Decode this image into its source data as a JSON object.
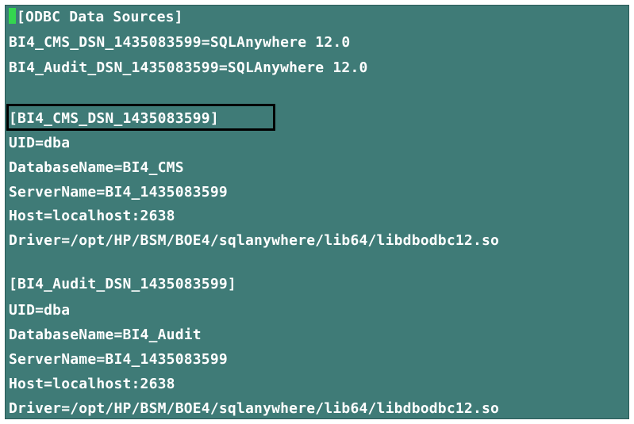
{
  "terminal": {
    "background": "#3f7b77",
    "text_color": "#ffffff",
    "cursor_color": "#34d64f",
    "highlight_border_color": "#000000",
    "lines": [
      "[ODBC Data Sources]",
      "BI4_CMS_DSN_1435083599=SQLAnywhere 12.0",
      "BI4_Audit_DSN_1435083599=SQLAnywhere 12.0",
      "",
      "[BI4_CMS_DSN_1435083599]",
      "UID=dba",
      "DatabaseName=BI4_CMS",
      "ServerName=BI4_1435083599",
      "Host=localhost:2638",
      "Driver=/opt/HP/BSM/BOE4/sqlanywhere/lib64/libdbodbc12.so",
      "",
      "[BI4_Audit_DSN_1435083599]",
      "UID=dba",
      "DatabaseName=BI4_Audit",
      "ServerName=BI4_1435083599",
      "Host=localhost:2638",
      "Driver=/opt/HP/BSM/BOE4/sqlanywhere/lib64/libdbodbc12.so"
    ],
    "highlighted_line_index": 4
  }
}
